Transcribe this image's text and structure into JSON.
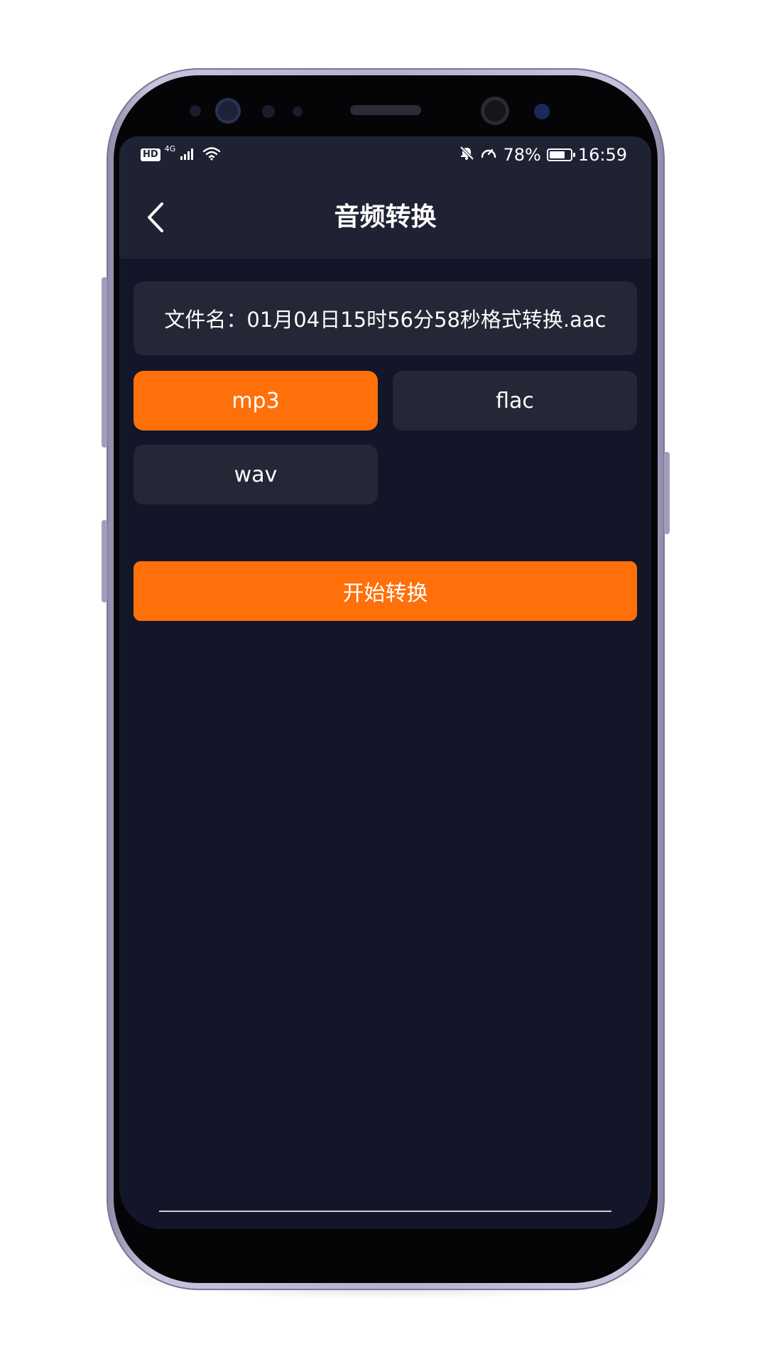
{
  "status_bar": {
    "hd": "HD",
    "network": "4G",
    "battery_percent": "78%",
    "battery_level": 0.78,
    "time": "16:59"
  },
  "header": {
    "title": "音频转换"
  },
  "file": {
    "label": "文件名：01月04日15时56分58秒格式转换.aac"
  },
  "formats": [
    {
      "label": "mp3",
      "selected": true
    },
    {
      "label": "flac",
      "selected": false
    },
    {
      "label": "wav",
      "selected": false
    }
  ],
  "actions": {
    "start_label": "开始转换"
  },
  "colors": {
    "accent": "#ff6f0a",
    "background": "#121628",
    "header": "#1f2233",
    "card": "#232736"
  },
  "icons": {
    "back": "chevron-left-icon",
    "signal": "signal-bars-icon",
    "wifi": "wifi-icon",
    "mute": "bell-off-icon",
    "speed": "speedometer-icon",
    "battery": "battery-icon"
  }
}
